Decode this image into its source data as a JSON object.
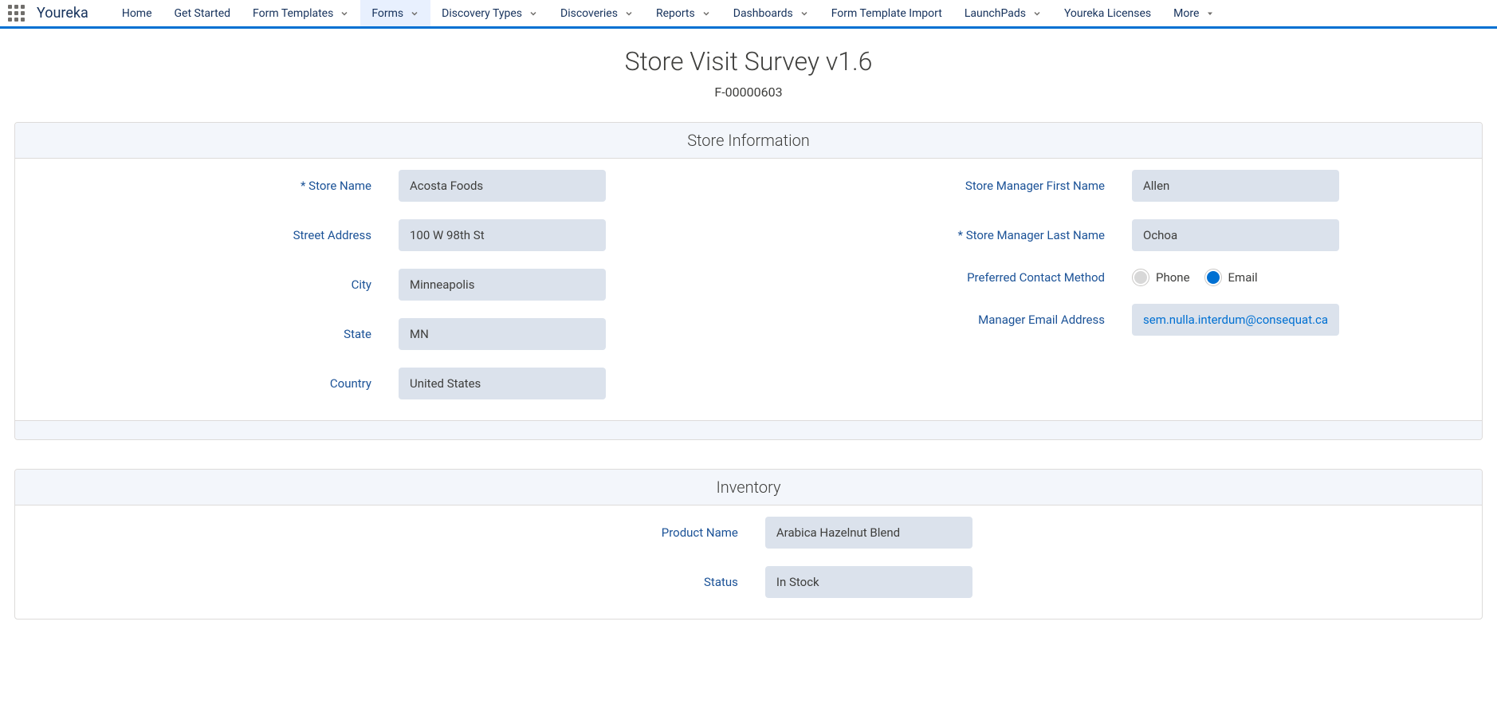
{
  "brand": "Youreka",
  "nav": {
    "home": "Home",
    "get_started": "Get Started",
    "form_templates": "Form Templates",
    "forms": "Forms",
    "discovery_types": "Discovery Types",
    "discoveries": "Discoveries",
    "reports": "Reports",
    "dashboards": "Dashboards",
    "form_template_import": "Form Template Import",
    "launchpads": "LaunchPads",
    "youreka_licenses": "Youreka Licenses",
    "more": "More"
  },
  "page": {
    "title": "Store Visit Survey v1.6",
    "subtitle": "F-00000603"
  },
  "sections": {
    "store_info": {
      "header": "Store Information",
      "labels": {
        "store_name": "* Store Name",
        "street_address": "Street Address",
        "city": "City",
        "state": "State",
        "country": "Country",
        "mgr_first": "Store Manager First Name",
        "mgr_last": "* Store Manager Last Name",
        "contact_method": "Preferred Contact Method",
        "mgr_email": "Manager Email Address"
      },
      "values": {
        "store_name": "Acosta Foods",
        "street_address": "100 W 98th St",
        "city": "Minneapolis",
        "state": "MN",
        "country": "United States",
        "mgr_first": "Allen",
        "mgr_last": "Ochoa",
        "mgr_email": "sem.nulla.interdum@consequat.ca"
      },
      "contact_method": {
        "options": {
          "phone": "Phone",
          "email": "Email"
        },
        "selected": "email"
      }
    },
    "inventory": {
      "header": "Inventory",
      "labels": {
        "product_name": "Product Name",
        "status": "Status"
      },
      "values": {
        "product_name": "Arabica Hazelnut Blend",
        "status": "In Stock"
      }
    }
  }
}
